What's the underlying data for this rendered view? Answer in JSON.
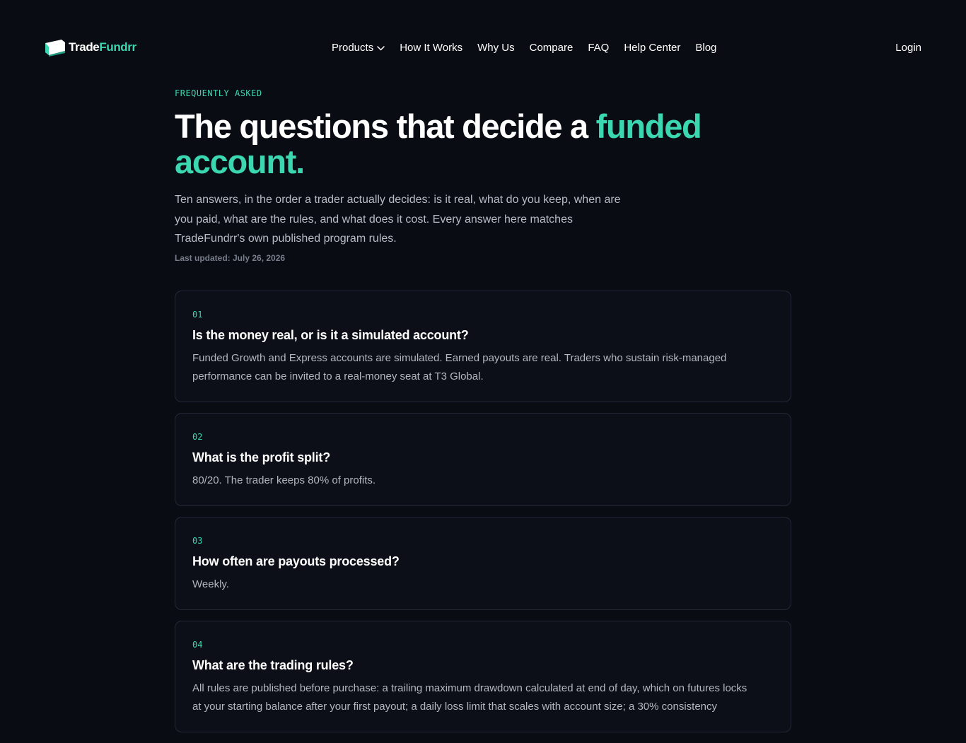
{
  "brand": {
    "name_part1": "Trade",
    "name_part2": "Fundrr",
    "accent_color": "#3ad7b1"
  },
  "nav": {
    "items": [
      {
        "label": "Products",
        "icon": "chevron-down-icon"
      },
      {
        "label": "How It Works"
      },
      {
        "label": "Why Us"
      },
      {
        "label": "Compare"
      },
      {
        "label": "FAQ"
      },
      {
        "label": "Help Center"
      },
      {
        "label": "Blog"
      }
    ],
    "login": "Login"
  },
  "hero": {
    "eyebrow": "FREQUENTLY ASKED",
    "title_main": "The questions that decide a ",
    "title_accent": "funded account.",
    "intro": "Ten answers, in the order a trader actually decides: is it real, what do you keep, when are you paid, what are the rules, and what does it cost. Every answer here matches TradeFundrr's own published program rules.",
    "updated": "Last updated: July 26, 2026"
  },
  "faq": [
    {
      "num": "01",
      "question": "Is the money real, or is it a simulated account?",
      "answer": "Funded Growth and Express accounts are simulated. Earned payouts are real. Traders who sustain risk-managed performance can be invited to a real-money seat at T3 Global."
    },
    {
      "num": "02",
      "question": "What is the profit split?",
      "answer": "80/20. The trader keeps 80% of profits."
    },
    {
      "num": "03",
      "question": "How often are payouts processed?",
      "answer": "Weekly."
    },
    {
      "num": "04",
      "question": "What are the trading rules?",
      "answer": "All rules are published before purchase: a trailing maximum drawdown calculated at end of day, which on futures locks at your starting balance after your first payout; a daily loss limit that scales with account size; a 30% consistency"
    }
  ],
  "colors": {
    "background": "#0a0c13",
    "card_background": "#0c0f18",
    "card_border": "#232836",
    "text_primary": "#ffffff",
    "text_muted": "#b8bcc7",
    "accent": "#3ad7b1"
  }
}
